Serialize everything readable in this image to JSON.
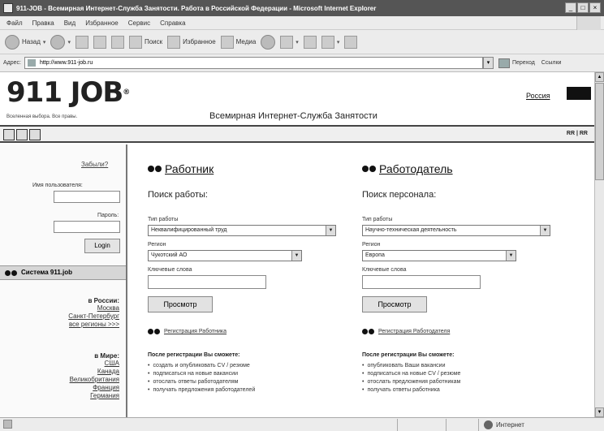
{
  "window": {
    "title": "911-JOB - Всемирная Интернет-Служба Занятости. Работа в Российской Федерации - Microsoft Internet Explorer",
    "buttons": [
      "_",
      "□",
      "×"
    ]
  },
  "menu": [
    "Файл",
    "Правка",
    "Вид",
    "Избранное",
    "Сервис",
    "Справка"
  ],
  "toolbar": {
    "back": "Назад",
    "search": "Поиск",
    "favorites": "Избранное",
    "media": "Медиа"
  },
  "address": {
    "label": "Адрес:",
    "url": "http://www.911-job.ru",
    "go": "Переход",
    "links": "Ссылки"
  },
  "site": {
    "logo": "911 JOB",
    "logo_reg": "®",
    "tagline": "Вселенная выбора. Все правы.",
    "slogan": "Всемирная Интернет-Служба Занятости",
    "lang_link": "Россия",
    "nav_code": "RR | RR"
  },
  "left": {
    "forgot": "Забыли?",
    "username_label": "Имя пользователя:",
    "password_label": "Пароль:",
    "login_button": "Login",
    "system_title": "Система 911.job",
    "russia": {
      "header": "в России:",
      "links": [
        "Москва",
        "Санкт-Петербург",
        "все регионы >>>"
      ]
    },
    "world": {
      "header": "в Мире:",
      "links": [
        "США",
        "Канада",
        "Великобритания",
        "Франция",
        "Германия"
      ]
    }
  },
  "worker": {
    "title": "Работник",
    "subtitle": "Поиск работы:",
    "type_label": "Тип работы",
    "type_value": "Неквалифицированный труд",
    "region_label": "Регион",
    "region_value": "Чукотский АО",
    "keywords_label": "Ключевые слова",
    "view_button": "Просмотр",
    "reg_link": "Регистрация Работника",
    "after_reg": "После регистрации Вы сможете:",
    "bullets": [
      "создать и опубликовать CV / резюме",
      "подписаться на новые вакансии",
      "отослать ответы работодателям",
      "получать предложения работодателей"
    ]
  },
  "employer": {
    "title": "Работодатель",
    "subtitle": "Поиск персонала:",
    "type_label": "Тип работы",
    "type_value": "Научно-техническая деятельность",
    "region_label": "Регион",
    "region_value": "Европа",
    "keywords_label": "Ключевые слова",
    "view_button": "Просмотр",
    "reg_link": "Регистрация Работодателя",
    "after_reg": "После регистрации Вы сможете:",
    "bullets": [
      "опубликовать Ваши вакансии",
      "подписаться на новые CV / резюме",
      "отослать предложения работникам",
      "получать ответы работника"
    ]
  },
  "status": {
    "zone": "Интернет"
  }
}
